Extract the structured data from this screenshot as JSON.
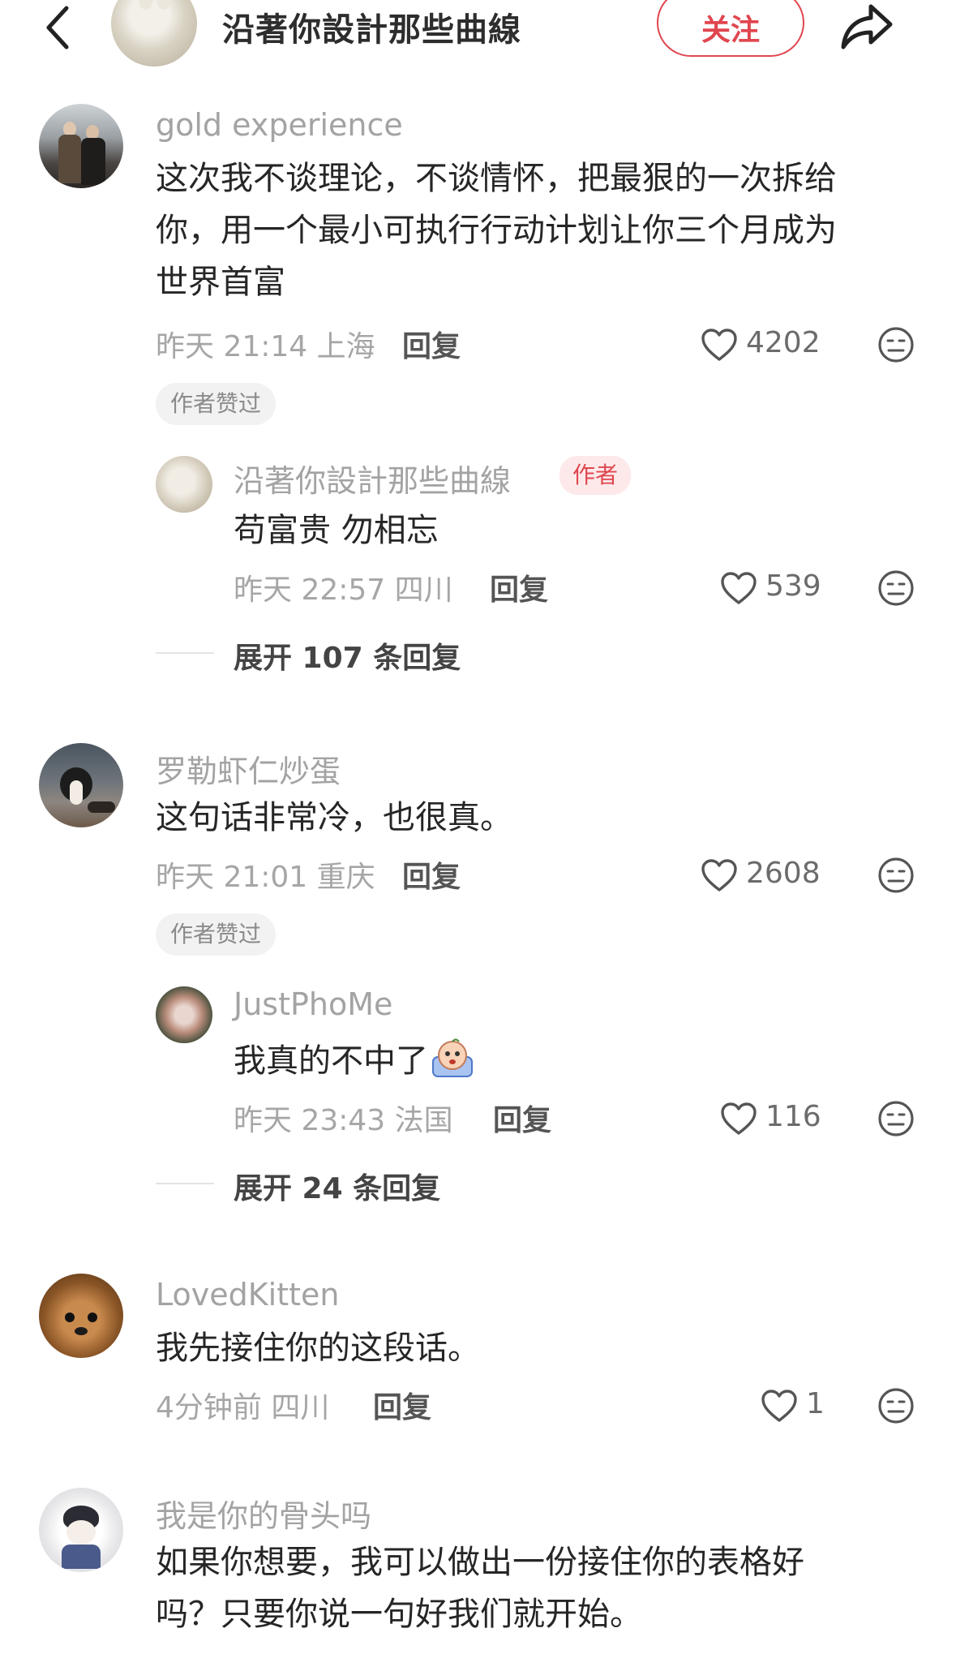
{
  "header": {
    "title": "沿著你設計那些曲線",
    "follow_label": "关注"
  },
  "comments": [
    {
      "username": "gold experience",
      "lines": [
        "这次我不谈理论，不谈情怀，把最狠的一次拆给",
        "你，用一个最小可执行行动计划让你三个月成为",
        "世界首富"
      ],
      "meta": "昨天 21:14 上海",
      "reply_label": "回复",
      "likes": "4202",
      "badge": "作者赞过",
      "sub_reply": {
        "username": "沿著你設計那些曲線",
        "author_tag": "作者",
        "text": "苟富贵 勿相忘",
        "meta": "昨天 22:57 四川",
        "reply_label": "回复",
        "likes": "539"
      },
      "expand_label": "展开 107 条回复"
    },
    {
      "username": "罗勒虾仁炒蛋",
      "lines": [
        "这句话非常冷，也很真。"
      ],
      "meta": "昨天 21:01 重庆",
      "reply_label": "回复",
      "likes": "2608",
      "badge": "作者赞过",
      "sub_reply": {
        "username": "JustPhoMe",
        "text": "我真的不中了",
        "meta": "昨天 23:43 法国",
        "reply_label": "回复",
        "likes": "116"
      },
      "expand_label": "展开 24 条回复"
    },
    {
      "username": "LovedKitten",
      "lines": [
        "我先接住你的这段话。"
      ],
      "meta": "4分钟前 四川",
      "reply_label": "回复",
      "likes": "1"
    },
    {
      "username": "我是你的骨头吗",
      "lines": [
        "如果你想要，我可以做出一份接住你的表格好",
        "吗？只要你说一句好我们就开始。"
      ]
    }
  ],
  "colors": {
    "accent": "#e0464f",
    "username": "#a3a3a3",
    "meta": "#a6a6a6"
  }
}
